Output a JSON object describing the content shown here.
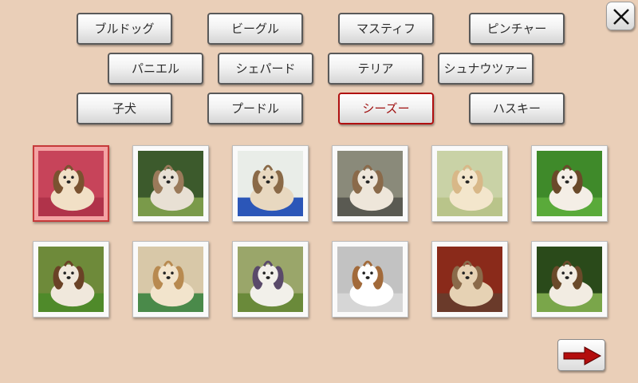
{
  "close_icon": "close-x-icon",
  "next_icon": "arrow-right-icon",
  "accent_color": "#b01010",
  "categories": [
    {
      "label": "ブルドッグ",
      "selected": false
    },
    {
      "label": "ビーグル",
      "selected": false
    },
    {
      "label": "マスティフ",
      "selected": false
    },
    {
      "label": "ピンチャー",
      "selected": false
    },
    {
      "label": "パニエル",
      "selected": false
    },
    {
      "label": "シェパード",
      "selected": false
    },
    {
      "label": "テリア",
      "selected": false
    },
    {
      "label": "シュナウツァー",
      "selected": false
    },
    {
      "label": "子犬",
      "selected": false
    },
    {
      "label": "プードル",
      "selected": false
    },
    {
      "label": "シーズー",
      "selected": true
    },
    {
      "label": "ハスキー",
      "selected": false
    }
  ],
  "photos": [
    {
      "selected": true,
      "bg": "#c7445a",
      "fur": "#f1e0c6",
      "ears": "#7a5230",
      "ground": "#b0334a"
    },
    {
      "selected": false,
      "bg": "#3c5a2c",
      "fur": "#e8e0d4",
      "ears": "#9a7a5a",
      "ground": "#7a9a4a"
    },
    {
      "selected": false,
      "bg": "#e9ede8",
      "fur": "#e8d8c0",
      "ears": "#8a6a48",
      "ground": "#2b56b8"
    },
    {
      "selected": false,
      "bg": "#8a8a7a",
      "fur": "#eee6da",
      "ears": "#8a6a4a",
      "ground": "#5a5a52"
    },
    {
      "selected": false,
      "bg": "#c9d2a6",
      "fur": "#f3e6cc",
      "ears": "#d8b888",
      "ground": "#b9c48a"
    },
    {
      "selected": false,
      "bg": "#3f8a2a",
      "fur": "#f4eee6",
      "ears": "#6a4a2a",
      "ground": "#5aaa3a"
    },
    {
      "selected": false,
      "bg": "#6e8a3a",
      "fur": "#f0e8dc",
      "ears": "#6a4226",
      "ground": "#4f8a2a"
    },
    {
      "selected": false,
      "bg": "#d8c8a8",
      "fur": "#f2e4cc",
      "ears": "#b88a50",
      "ground": "#4a8a4a"
    },
    {
      "selected": false,
      "bg": "#9aa66a",
      "fur": "#f2f0ea",
      "ears": "#5a4a6a",
      "ground": "#6a8a3a"
    },
    {
      "selected": false,
      "bg": "#c2c2c2",
      "fur": "#ffffff",
      "ears": "#a26a3a",
      "ground": "#d6d6d6"
    },
    {
      "selected": false,
      "bg": "#8a2a1a",
      "fur": "#e6d2b4",
      "ears": "#8a6a4a",
      "ground": "#6a3a2a"
    },
    {
      "selected": false,
      "bg": "#2a4a1a",
      "fur": "#f2ece2",
      "ears": "#6a4a2a",
      "ground": "#7aa64a"
    }
  ]
}
